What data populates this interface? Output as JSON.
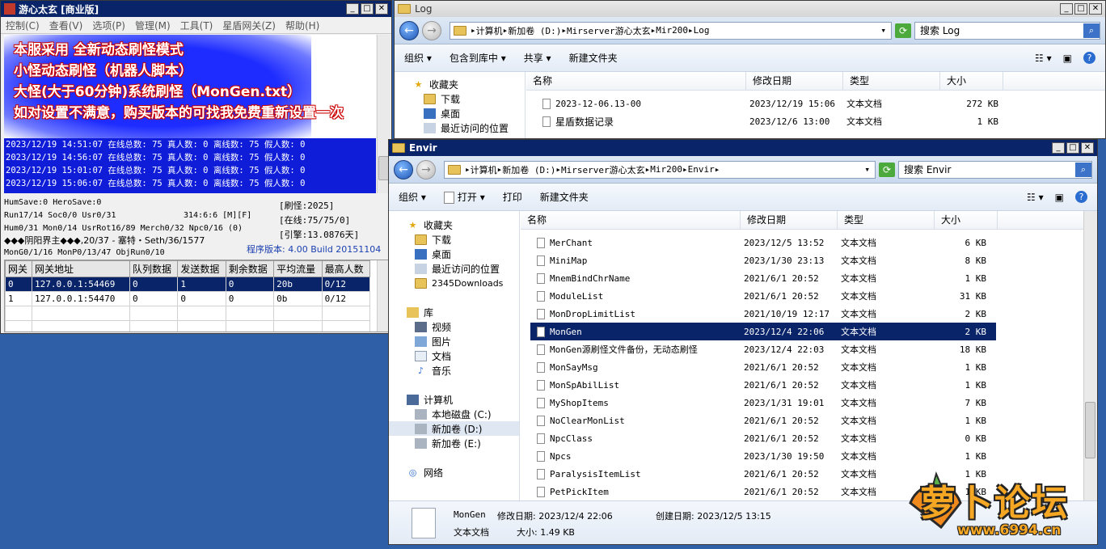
{
  "server_window": {
    "title": "游心太玄 [商业版]",
    "menus": [
      "控制(C)",
      "查看(V)",
      "选项(P)",
      "管理(M)",
      "工具(T)",
      "星盾网关(Z)",
      "帮助(H)"
    ],
    "overlay_lines": [
      "本服采用 全新动态刷怪模式",
      "小怪动态刷怪（机器人脚本）",
      "大怪(大于60分钟)系统刷怪（MonGen.txt）",
      "如对设置不满意，购买版本的可找我免费重新设置一次"
    ],
    "log_lines": [
      "2023/12/19 14:51:07 在线总数: 75 真人数: 0 离线数: 75 假人数: 0",
      "2023/12/19 14:56:07 在线总数: 75 真人数: 0 离线数: 75 假人数: 0",
      "2023/12/19 15:01:07 在线总数: 75 真人数: 0 离线数: 75 假人数: 0",
      "2023/12/19 15:06:07 在线总数: 75 真人数: 0 离线数: 75 假人数: 0"
    ],
    "status": {
      "hum_save": "HumSave:0 HeroSave:0",
      "run": "Run17/14 Soc0/0 Usr0/31",
      "coords": "314:6:6 [M][F]",
      "hum": "Hum0/31 Mon0/14 UsrRot16/89 Merch0/32 Npc0/16 (0)",
      "player": "◆◆◆阴阳界主◆◆◆,20/37 - 塞特・Seth/36/1577",
      "mongen": "MonG0/1/16 MonP0/13/47 ObjRun0/10",
      "refresh": "[刷怪:2025]",
      "online": "[在线:75/75/0]",
      "engine": "[引擎:13.0876天]",
      "version": "程序版本: 4.00 Build 20151104"
    },
    "gateway_table": {
      "headers": [
        "网关",
        "网关地址",
        "队列数据",
        "发送数据",
        "剩余数据",
        "平均流量",
        "最高人数"
      ],
      "rows": [
        [
          "0",
          "127.0.0.1:54469",
          "0",
          "1",
          "0",
          "20b",
          "0/12"
        ],
        [
          "1",
          "127.0.0.1:54470",
          "0",
          "0",
          "0",
          "0b",
          "0/12"
        ]
      ]
    }
  },
  "log_window": {
    "title": "Log",
    "path": [
      "计算机",
      "新加卷 (D:)",
      "Mirserver游心太玄",
      "Mir200",
      "Log"
    ],
    "search_placeholder": "搜索 Log",
    "toolbar": [
      "组织",
      "包含到库中",
      "共享",
      "新建文件夹"
    ],
    "nav": [
      "收藏夹",
      "下载",
      "桌面",
      "最近访问的位置"
    ],
    "columns": [
      "名称",
      "修改日期",
      "类型",
      "大小"
    ],
    "files": [
      {
        "name": "2023-12-06.13-00",
        "date": "2023/12/19 15:06",
        "type": "文本文档",
        "size": "272 KB"
      },
      {
        "name": "星盾数据记录",
        "date": "2023/12/6 13:00",
        "type": "文本文档",
        "size": "1 KB"
      }
    ]
  },
  "envir_window": {
    "title": "Envir",
    "path": [
      "计算机",
      "新加卷 (D:)",
      "Mirserver游心太玄",
      "Mir200",
      "Envir"
    ],
    "search_placeholder": "搜索 Envir",
    "toolbar": [
      "组织",
      "打开",
      "打印",
      "新建文件夹"
    ],
    "nav": {
      "favorites": [
        "收藏夹",
        "下载",
        "桌面",
        "最近访问的位置",
        "2345Downloads"
      ],
      "library": [
        "库",
        "视频",
        "图片",
        "文档",
        "音乐"
      ],
      "computer": [
        "计算机",
        "本地磁盘 (C:)",
        "新加卷 (D:)",
        "新加卷 (E:)"
      ],
      "network": "网络"
    },
    "columns": [
      "名称",
      "修改日期",
      "类型",
      "大小"
    ],
    "files": [
      {
        "name": "MerChant",
        "date": "2023/12/5 13:52",
        "type": "文本文档",
        "size": "6 KB"
      },
      {
        "name": "MiniMap",
        "date": "2023/1/30 23:13",
        "type": "文本文档",
        "size": "8 KB"
      },
      {
        "name": "MnemBindChrName",
        "date": "2021/6/1 20:52",
        "type": "文本文档",
        "size": "1 KB"
      },
      {
        "name": "ModuleList",
        "date": "2021/6/1 20:52",
        "type": "文本文档",
        "size": "31 KB"
      },
      {
        "name": "MonDropLimitList",
        "date": "2021/10/19 12:17",
        "type": "文本文档",
        "size": "2 KB"
      },
      {
        "name": "MonGen",
        "date": "2023/12/4 22:06",
        "type": "文本文档",
        "size": "2 KB",
        "selected": true
      },
      {
        "name": "MonGen源刷怪文件备份，无动态刷怪",
        "date": "2023/12/4 22:03",
        "type": "文本文档",
        "size": "18 KB"
      },
      {
        "name": "MonSayMsg",
        "date": "2021/6/1 20:52",
        "type": "文本文档",
        "size": "1 KB"
      },
      {
        "name": "MonSpAbilList",
        "date": "2021/6/1 20:52",
        "type": "文本文档",
        "size": "1 KB"
      },
      {
        "name": "MyShopItems",
        "date": "2023/1/31 19:01",
        "type": "文本文档",
        "size": "7 KB"
      },
      {
        "name": "NoClearMonList",
        "date": "2021/6/1 20:52",
        "type": "文本文档",
        "size": "1 KB"
      },
      {
        "name": "NpcClass",
        "date": "2021/6/1 20:52",
        "type": "文本文档",
        "size": "0 KB"
      },
      {
        "name": "Npcs",
        "date": "2023/1/30 19:50",
        "type": "文本文档",
        "size": "1 KB"
      },
      {
        "name": "ParalysisItemList",
        "date": "2021/6/1 20:52",
        "type": "文本文档",
        "size": "1 KB"
      },
      {
        "name": "PetPickItem",
        "date": "2021/6/1 20:52",
        "type": "文本文档",
        "size": "1 KB"
      }
    ],
    "details": {
      "name": "MonGen",
      "modified": "修改日期: 2023/12/4 22:06",
      "created": "创建日期: 2023/12/5 13:15",
      "type": "文本文档",
      "size": "大小: 1.49 KB"
    }
  },
  "watermark": {
    "logo_text": "萝卜论坛",
    "url": "www.6994.cn"
  }
}
